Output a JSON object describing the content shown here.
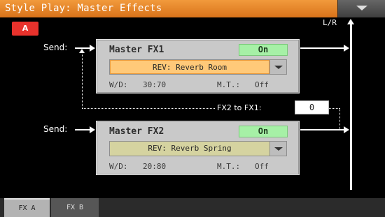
{
  "header": {
    "title": "Style Play: Master Effects",
    "menu_icon": "chevron-down-icon"
  },
  "badge": {
    "label": "A",
    "color": "#e8322c"
  },
  "bus_label": "L/R",
  "fx1": {
    "send_label": "Send:",
    "title": "Master FX1",
    "state": "On",
    "effect": "REV: Reverb Room",
    "wd_label": "W/D:",
    "wd_value": "30:70",
    "mt_label": "M.T.:",
    "mt_value": "Off"
  },
  "fx2": {
    "send_label": "Send:",
    "title": "Master FX2",
    "state": "On",
    "effect": "REV: Reverb Spring",
    "wd_label": "W/D:",
    "wd_value": "20:80",
    "mt_label": "M.T.:",
    "mt_value": "Off"
  },
  "fx2_to_fx1": {
    "label": "FX2 to FX1:",
    "value": "0"
  },
  "tabs": [
    {
      "label": "FX A",
      "selected": true
    },
    {
      "label": "FX B",
      "selected": false
    }
  ],
  "colors": {
    "title_bar": "#e8862a",
    "on_indicator": "#a6f0a6",
    "fx1_effect_bg": "#ffc979",
    "fx2_effect_bg": "#d5d3a0"
  }
}
